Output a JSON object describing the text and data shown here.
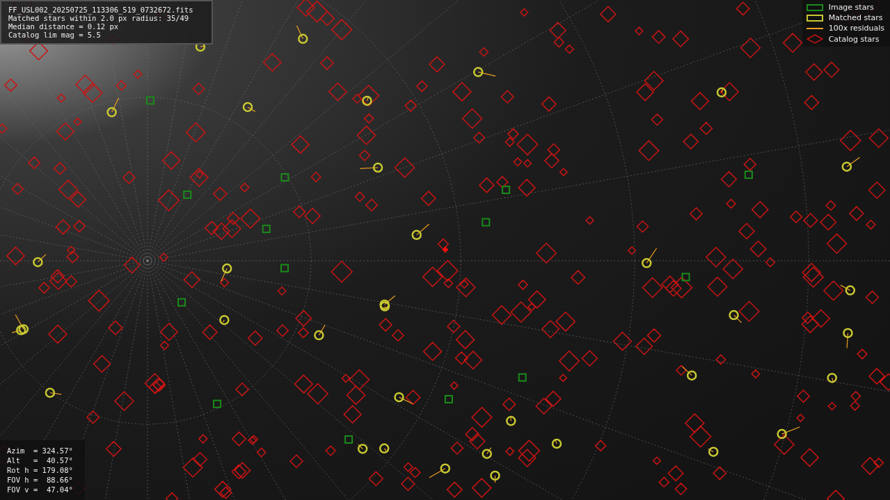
{
  "info_box": {
    "lines": [
      "FF_USL002_20250725_113306_519_0732672.fits",
      "Matched stars within 2.0 px radius: 35/49",
      "Median distance = 0.12 px",
      "Catalog lim mag = 5.5"
    ]
  },
  "legend": {
    "items": [
      {
        "kind": "box",
        "label": "Image stars",
        "color": "#1a8c1a"
      },
      {
        "kind": "box",
        "label": "Matched stars",
        "color": "#c8c832"
      },
      {
        "kind": "line",
        "label": "100x residuals",
        "color": "#f0a020"
      },
      {
        "kind": "diamond",
        "label": "Catalog stars",
        "color": "#c81414"
      }
    ]
  },
  "pointing_box": {
    "lines": [
      "Azim  = 324.57°",
      "Alt   =  40.57°",
      "Rot h = 179.08°",
      "FOV h =  88.66°",
      "FOV v =  47.04°"
    ]
  }
}
